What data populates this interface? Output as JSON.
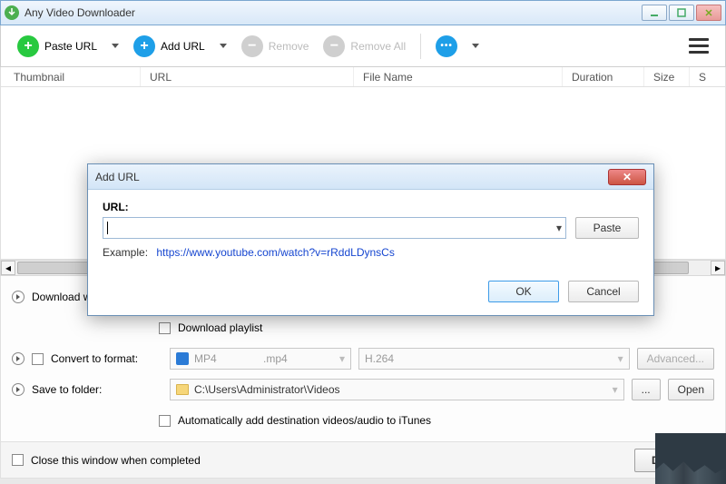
{
  "window": {
    "title": "Any Video Downloader"
  },
  "toolbar": {
    "paste_url": "Paste URL",
    "add_url": "Add URL",
    "remove": "Remove",
    "remove_all": "Remove All"
  },
  "columns": {
    "thumbnail": "Thumbnail",
    "url": "URL",
    "filename": "File Name",
    "duration": "Duration",
    "size": "Size",
    "s": "S"
  },
  "options": {
    "download_label": "Download w",
    "download_playlist": "Download playlist",
    "convert_label": "Convert to format:",
    "format_name": "MP4",
    "format_ext": ".mp4",
    "codec": "H.264",
    "advanced": "Advanced...",
    "save_label": "Save to folder:",
    "save_path": "C:\\Users\\Administrator\\Videos",
    "browse": "...",
    "open": "Open",
    "itunes": "Automatically add destination videos/audio to iTunes"
  },
  "footer": {
    "close_when_done": "Close this window when completed",
    "download": "Downloa"
  },
  "dialog": {
    "title": "Add URL",
    "url_label": "URL:",
    "paste": "Paste",
    "example_label": "Example:",
    "example_url": "https://www.youtube.com/watch?v=rRddLDynsCs",
    "ok": "OK",
    "cancel": "Cancel"
  }
}
